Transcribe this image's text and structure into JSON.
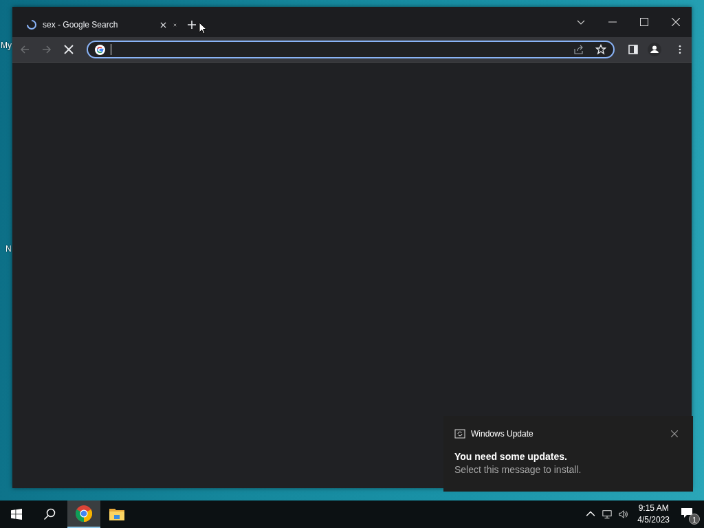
{
  "desktop": {
    "icon_labels": [
      "My",
      "N"
    ]
  },
  "browser": {
    "tabs": [
      {
        "title": "sex - Google Search",
        "loading": true
      }
    ],
    "navigation": {
      "back_disabled": true,
      "forward_disabled": true,
      "loading": true
    },
    "address_bar": {
      "focused": true
    }
  },
  "notification": {
    "app": "Windows Update",
    "title": "You need some updates.",
    "message": "Select this message to install."
  },
  "taskbar": {
    "apps": [
      {
        "kind": "chrome",
        "selected": true
      },
      {
        "kind": "folder",
        "selected": false
      }
    ],
    "time": "9:15 AM",
    "date": "4/5/2023",
    "notification_count": "1"
  }
}
